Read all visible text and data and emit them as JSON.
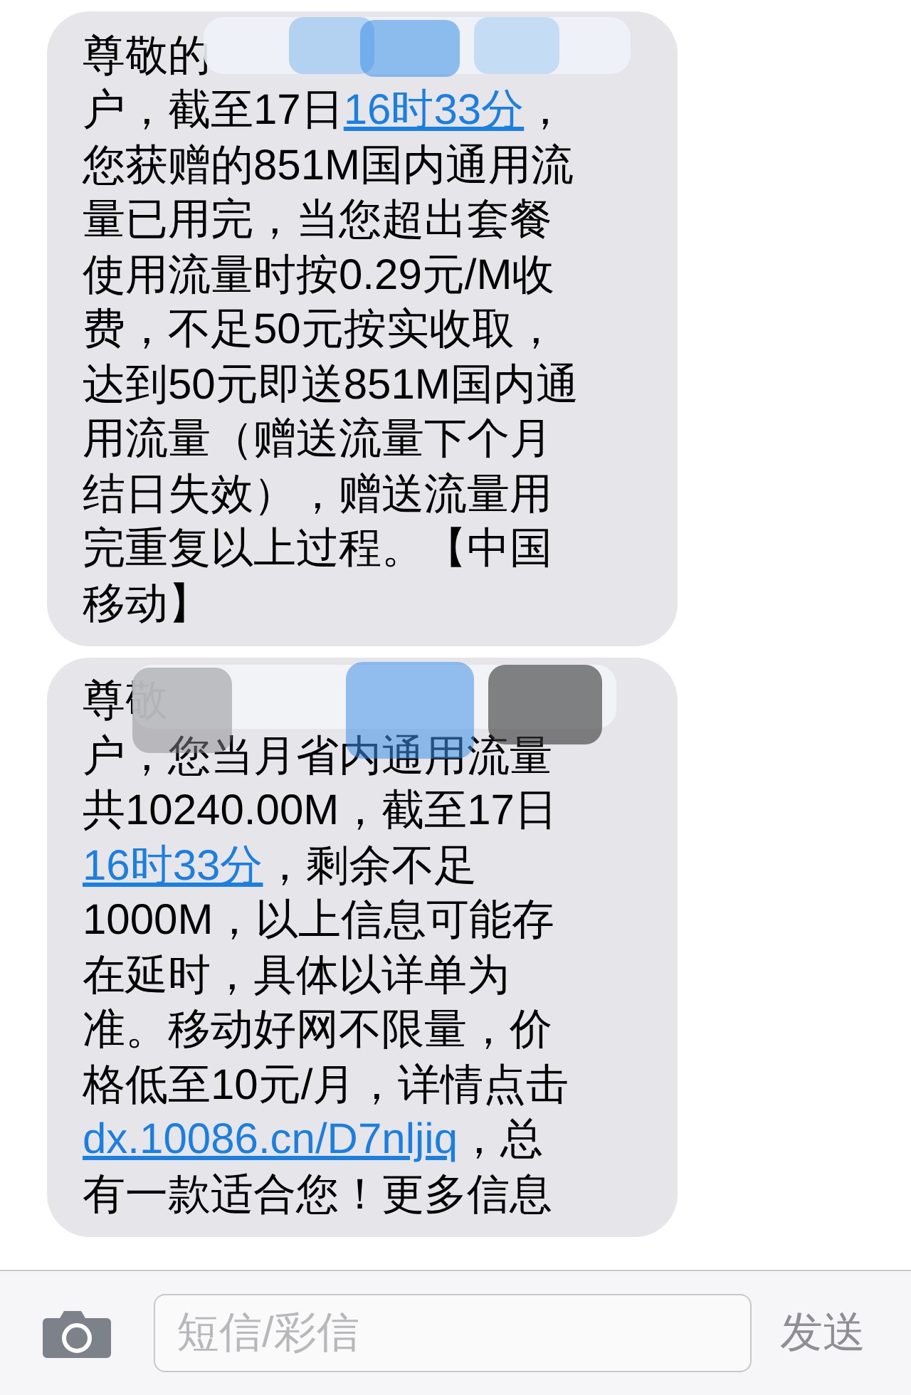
{
  "messages": [
    {
      "lines": [
        [
          {
            "text": "尊敬的",
            "link": false
          }
        ],
        [
          {
            "text": "户，截至17日",
            "link": false
          },
          {
            "text": "16时33分",
            "link": true
          },
          {
            "text": "，",
            "link": false
          }
        ],
        [
          {
            "text": "您获赠的851M国内通用流",
            "link": false
          }
        ],
        [
          {
            "text": "量已用完，当您超出套餐",
            "link": false
          }
        ],
        [
          {
            "text": "使用流量时按0.29元/M收",
            "link": false
          }
        ],
        [
          {
            "text": "费，不足50元按实收取，",
            "link": false
          }
        ],
        [
          {
            "text": "达到50元即送851M国内通",
            "link": false
          }
        ],
        [
          {
            "text": "用流量（赠送流量下个月",
            "link": false
          }
        ],
        [
          {
            "text": "结日失效），赠送流量用",
            "link": false
          }
        ],
        [
          {
            "text": "完重复以上过程。【中国",
            "link": false
          }
        ],
        [
          {
            "text": "移动】",
            "link": false
          }
        ]
      ]
    },
    {
      "lines": [
        [
          {
            "text": "尊敬",
            "link": false
          }
        ],
        [
          {
            "text": "户，您当月省内通用流量",
            "link": false
          }
        ],
        [
          {
            "text": "共10240.00M，截至17日",
            "link": false
          }
        ],
        [
          {
            "text": "16时33分",
            "link": true
          },
          {
            "text": "，剩余不足",
            "link": false
          }
        ],
        [
          {
            "text": "1000M，以上信息可能存",
            "link": false
          }
        ],
        [
          {
            "text": "在延时，具体以详单为",
            "link": false
          }
        ],
        [
          {
            "text": "准。移动好网不限量，价",
            "link": false
          }
        ],
        [
          {
            "text": "格低至10元/月，详情点击",
            "link": false
          }
        ],
        [
          {
            "text": "dx.10086.cn/D7nljiq",
            "link": true
          },
          {
            "text": "，总",
            "link": false
          }
        ],
        [
          {
            "text": "有一款适合您！更多信息",
            "link": false
          }
        ]
      ]
    }
  ],
  "compose": {
    "placeholder": "短信/彩信",
    "send": "发送"
  }
}
